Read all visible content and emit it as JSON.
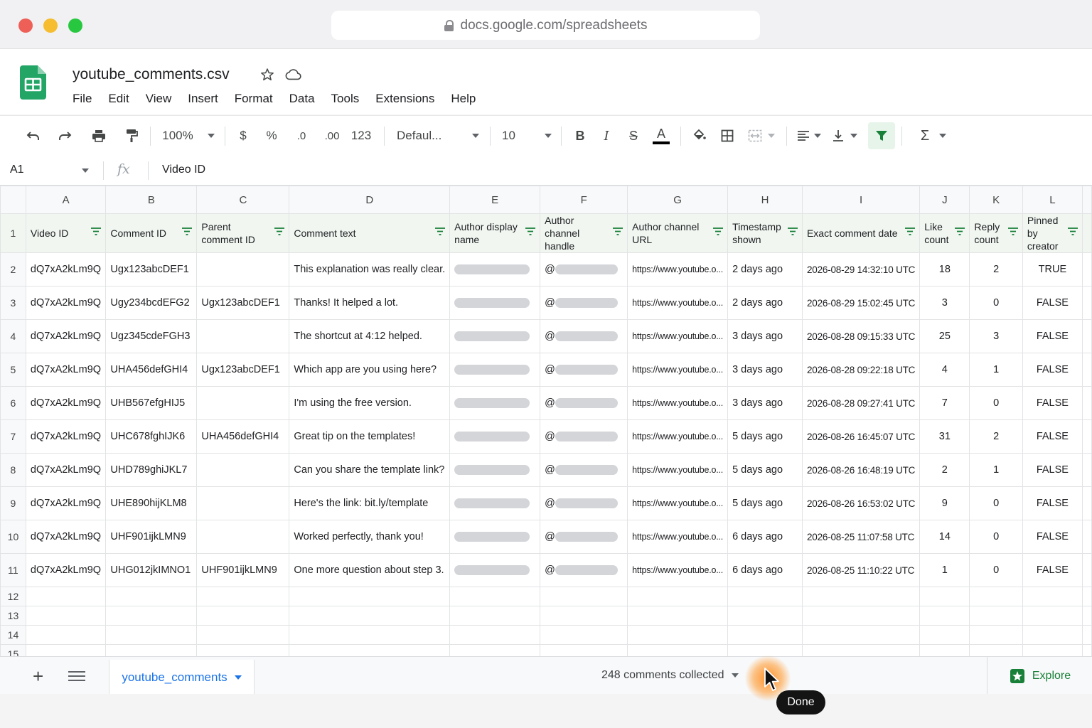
{
  "browser": {
    "url": "docs.google.com/spreadsheets"
  },
  "app": {
    "title": "youtube_comments.csv",
    "menu": [
      "File",
      "Edit",
      "View",
      "Insert",
      "Format",
      "Data",
      "Tools",
      "Extensions",
      "Help"
    ]
  },
  "toolbar": {
    "zoom": "100%",
    "currency": "$",
    "percent": "%",
    "dec_decrease": ".0",
    "dec_increase": ".00",
    "number_format": "123",
    "font": "Defaul...",
    "font_size": "10",
    "bold": "B",
    "italic": "I",
    "strike": "S",
    "text_color": "A",
    "sum": "Σ"
  },
  "formula_bar": {
    "cell_ref": "A1",
    "value": "Video ID"
  },
  "grid": {
    "columns": [
      "A",
      "B",
      "C",
      "D",
      "E",
      "F",
      "G",
      "H",
      "I",
      "J",
      "K",
      "L"
    ],
    "headers": [
      "Video ID",
      "Comment ID",
      "Parent comment ID",
      "Comment text",
      "Author display name",
      "Author channel handle",
      "Author channel URL",
      "Timestamp shown",
      "Exact comment date",
      "Like count",
      "Reply count",
      "Pinned by creator"
    ],
    "rows": [
      {
        "num": "2",
        "video": "dQ7xA2kLm9Q",
        "comment_id": "Ugx123abcDEF1",
        "parent": "",
        "text": "This explanation was really clear.",
        "handle": "@",
        "url": "https://www.youtube.o...",
        "shown": "2 days ago",
        "date": "2026-08-29 14:32:10 UTC",
        "likes": "18",
        "replies": "2",
        "pinned": "TRUE"
      },
      {
        "num": "3",
        "video": "dQ7xA2kLm9Q",
        "comment_id": "Ugy234bcdEFG2",
        "parent": "Ugx123abcDEF1",
        "text": "Thanks! It helped a lot.",
        "handle": "@",
        "url": "https://www.youtube.o...",
        "shown": "2 days ago",
        "date": "2026-08-29 15:02:45 UTC",
        "likes": "3",
        "replies": "0",
        "pinned": "FALSE"
      },
      {
        "num": "4",
        "video": "dQ7xA2kLm9Q",
        "comment_id": "Ugz345cdeFGH3",
        "parent": "",
        "text": "The shortcut at 4:12 helped.",
        "handle": "@",
        "url": "https://www.youtube.o...",
        "shown": "3 days ago",
        "date": "2026-08-28 09:15:33 UTC",
        "likes": "25",
        "replies": "3",
        "pinned": "FALSE"
      },
      {
        "num": "5",
        "video": "dQ7xA2kLm9Q",
        "comment_id": "UHA456defGHI4",
        "parent": "Ugx123abcDEF1",
        "text": "Which app are you using here?",
        "handle": "@",
        "url": "https://www.youtube.o...",
        "shown": "3 days ago",
        "date": "2026-08-28 09:22:18 UTC",
        "likes": "4",
        "replies": "1",
        "pinned": "FALSE"
      },
      {
        "num": "6",
        "video": "dQ7xA2kLm9Q",
        "comment_id": "UHB567efgHIJ5",
        "parent": "",
        "text": "I'm using the free version.",
        "handle": "@",
        "url": "https://www.youtube.o...",
        "shown": "3 days ago",
        "date": "2026-08-28 09:27:41 UTC",
        "likes": "7",
        "replies": "0",
        "pinned": "FALSE"
      },
      {
        "num": "7",
        "video": "dQ7xA2kLm9Q",
        "comment_id": "UHC678fghIJK6",
        "parent": "UHA456defGHI4",
        "text": "Great tip on the templates!",
        "handle": "@",
        "url": "https://www.youtube.o...",
        "shown": "5 days ago",
        "date": "2026-08-26 16:45:07 UTC",
        "likes": "31",
        "replies": "2",
        "pinned": "FALSE"
      },
      {
        "num": "8",
        "video": "dQ7xA2kLm9Q",
        "comment_id": "UHD789ghiJKL7",
        "parent": "",
        "text": "Can you share the template link?",
        "handle": "@",
        "url": "https://www.youtube.o...",
        "shown": "5 days ago",
        "date": "2026-08-26 16:48:19 UTC",
        "likes": "2",
        "replies": "1",
        "pinned": "FALSE"
      },
      {
        "num": "9",
        "video": "dQ7xA2kLm9Q",
        "comment_id": "UHE890hijKLM8",
        "parent": "",
        "text": "Here's the link: bit.ly/template",
        "handle": "@",
        "url": "https://www.youtube.o...",
        "shown": "5 days ago",
        "date": "2026-08-26 16:53:02 UTC",
        "likes": "9",
        "replies": "0",
        "pinned": "FALSE"
      },
      {
        "num": "10",
        "video": "dQ7xA2kLm9Q",
        "comment_id": "UHF901ijkLMN9",
        "parent": "",
        "text": "Worked perfectly, thank you!",
        "handle": "@",
        "url": "https://www.youtube.o...",
        "shown": "6 days ago",
        "date": "2026-08-25 11:07:58 UTC",
        "likes": "14",
        "replies": "0",
        "pinned": "FALSE"
      },
      {
        "num": "11",
        "video": "dQ7xA2kLm9Q",
        "comment_id": "UHG012jkIMNO1",
        "parent": "UHF901ijkLMN9",
        "text": "One more question about step 3.",
        "handle": "@",
        "url": "https://www.youtube.o...",
        "shown": "6 days ago",
        "date": "2026-08-25 11:10:22 UTC",
        "likes": "1",
        "replies": "0",
        "pinned": "FALSE"
      }
    ],
    "empty_rows": [
      "12",
      "13",
      "14",
      "15"
    ]
  },
  "bottom": {
    "sheet_tab": "youtube_comments",
    "status": "248 comments collected",
    "explore": "Explore"
  },
  "overlay": {
    "done_label": "Done"
  },
  "colors": {
    "sheets_green": "#188038",
    "tab_blue": "#1a73e8",
    "header_bg": "#f1f6f1"
  }
}
